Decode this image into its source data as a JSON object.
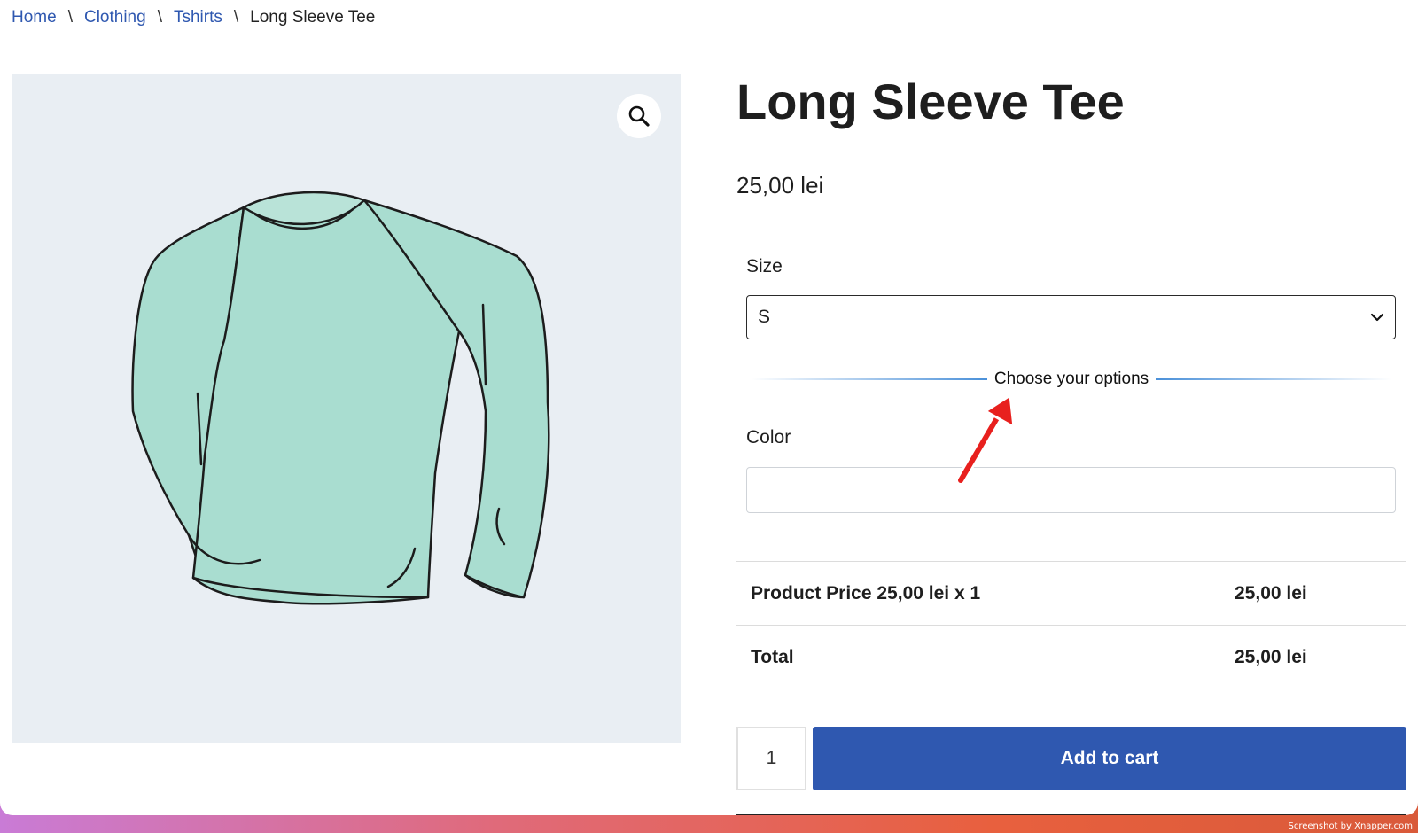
{
  "breadcrumb": {
    "items": [
      "Home",
      "Clothing",
      "Tshirts"
    ],
    "current": "Long Sleeve Tee",
    "separator": "\\"
  },
  "gallery": {
    "zoom_icon": "magnifier-icon",
    "image_subject": "long-sleeve-tee-illustration"
  },
  "product": {
    "title": "Long Sleeve Tee",
    "price": "25,00 lei",
    "size_label": "Size",
    "size_value": "S",
    "options_divider": "Choose your options",
    "color_label": "Color",
    "color_value": ""
  },
  "totals": {
    "rows": [
      {
        "label": "Product Price 25,00 lei x 1",
        "value": "25,00 lei"
      },
      {
        "label": "Total",
        "value": "25,00 lei"
      }
    ]
  },
  "cart": {
    "quantity": "1",
    "add_label": "Add to cart"
  },
  "colors": {
    "link": "#2f58b0",
    "button": "#2f58b0",
    "shirt": "#a9ddd0",
    "annotation_arrow": "#e8201e"
  },
  "footer": {
    "credit": "Screenshot by Xnapper.com"
  }
}
